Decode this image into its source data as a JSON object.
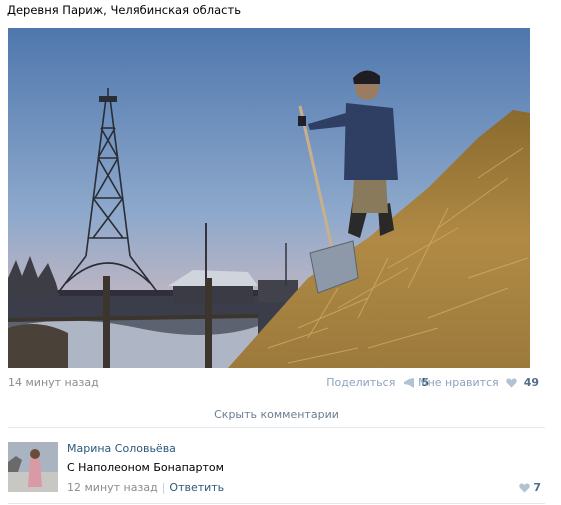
{
  "post": {
    "caption": "Деревня Париж, Челябинская область",
    "time": "14 минут назад",
    "share_label": "Поделиться",
    "share_count": "5",
    "like_label": "Мне нравится",
    "like_count": "49",
    "share_icon": "megaphone-icon",
    "like_icon": "heart-icon"
  },
  "comments_toggle": "Скрыть комментарии",
  "comment": {
    "author": "Марина Соловьёва",
    "text": "С Наполеоном Бонапартом",
    "time": "12 минут назад",
    "reply_label": "Ответить",
    "like_count": "7"
  },
  "colors": {
    "link": "#2b587a",
    "muted": "#8c8c8c",
    "accent_light": "#8ea3bd"
  }
}
